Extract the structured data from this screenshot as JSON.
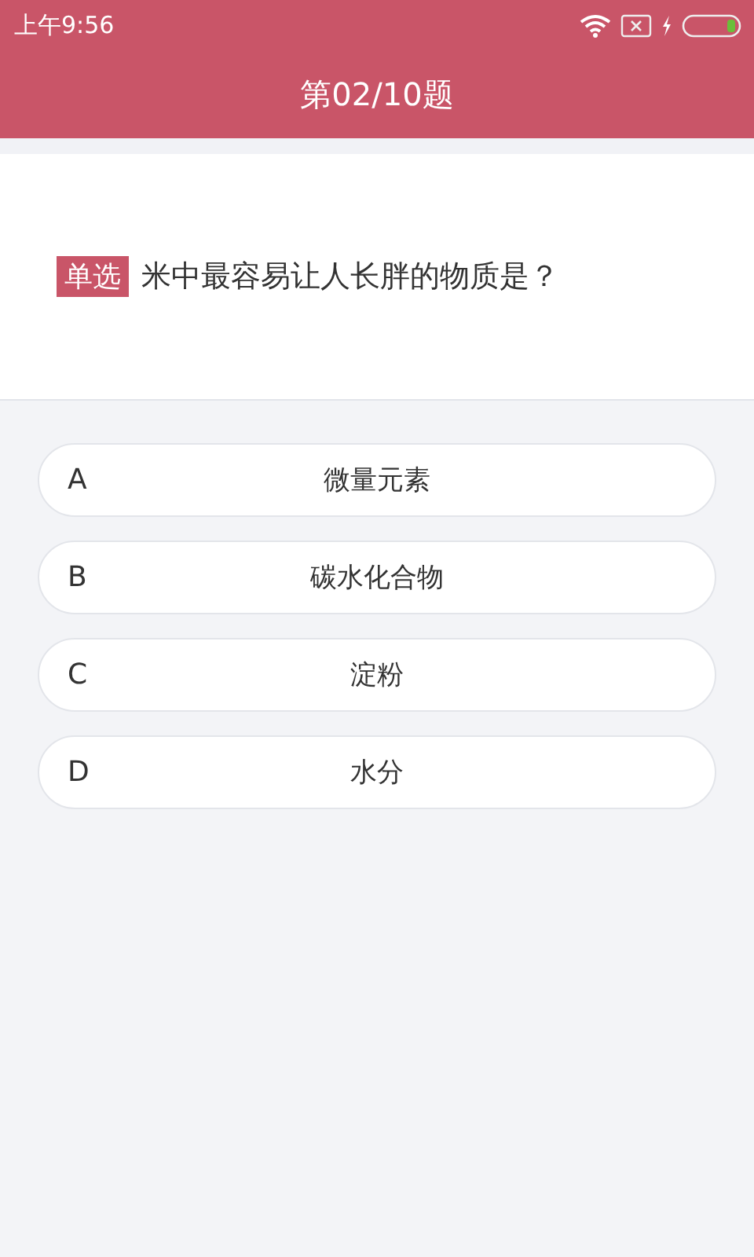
{
  "status_bar": {
    "time": "上午9:56"
  },
  "header": {
    "title": "第02/10题"
  },
  "question": {
    "tag": "单选",
    "text": "米中最容易让人长胖的物质是？"
  },
  "options": [
    {
      "letter": "A",
      "text": "微量元素"
    },
    {
      "letter": "B",
      "text": "碳水化合物"
    },
    {
      "letter": "C",
      "text": "淀粉"
    },
    {
      "letter": "D",
      "text": "水分"
    }
  ]
}
